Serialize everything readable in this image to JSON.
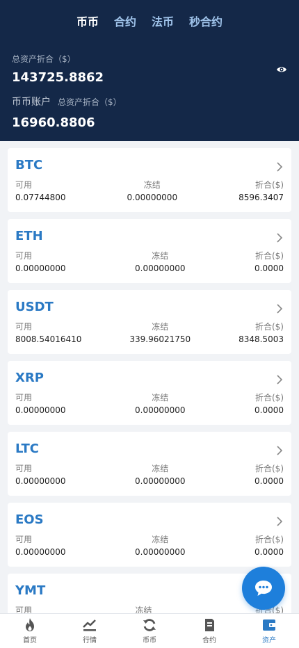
{
  "tabs": [
    "币币",
    "合约",
    "法币",
    "秒合约"
  ],
  "summary": {
    "total_label": "总资产折合（$）",
    "total_value": "143725.8862",
    "account_title": "币币账户",
    "account_sub": "总资产折合（$）",
    "account_value": "16960.8806"
  },
  "columns": {
    "available": "可用",
    "frozen": "冻结",
    "converted": "折合($)"
  },
  "assets": [
    {
      "coin": "BTC",
      "available": "0.07744800",
      "frozen": "0.00000000",
      "converted": "8596.3407"
    },
    {
      "coin": "ETH",
      "available": "0.00000000",
      "frozen": "0.00000000",
      "converted": "0.0000"
    },
    {
      "coin": "USDT",
      "available": "8008.54016410",
      "frozen": "339.96021750",
      "converted": "8348.5003"
    },
    {
      "coin": "XRP",
      "available": "0.00000000",
      "frozen": "0.00000000",
      "converted": "0.0000"
    },
    {
      "coin": "LTC",
      "available": "0.00000000",
      "frozen": "0.00000000",
      "converted": "0.0000"
    },
    {
      "coin": "EOS",
      "available": "0.00000000",
      "frozen": "0.00000000",
      "converted": "0.0000"
    },
    {
      "coin": "YMT",
      "available": "",
      "frozen": "",
      "converted": ""
    }
  ],
  "nav": [
    "首页",
    "行情",
    "币币",
    "合约",
    "资产"
  ],
  "colors": {
    "header_bg": "#142848",
    "accent": "#2a79c4",
    "fab": "#1e7fdb"
  },
  "icons": {
    "eye": "eye-icon",
    "chevron": "chevron-right-icon",
    "fab": "chat-icon",
    "nav": [
      "flame-icon",
      "chart-icon",
      "refresh-icon",
      "document-icon",
      "wallet-icon"
    ]
  }
}
